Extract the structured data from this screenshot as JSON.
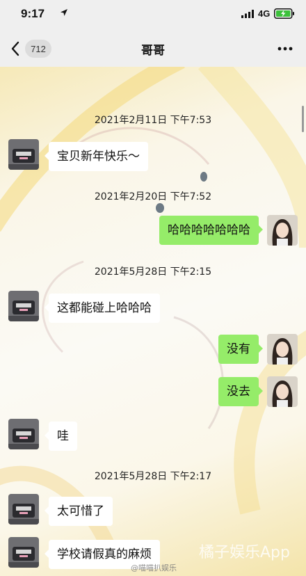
{
  "status_bar": {
    "time": "9:17",
    "network": "4G"
  },
  "nav": {
    "back_count": "712",
    "title": "哥哥"
  },
  "messages": [
    {
      "type": "timestamp",
      "text": "2021年2月11日 下午7:53"
    },
    {
      "type": "message",
      "side": "left",
      "text": "宝贝新年快乐～"
    },
    {
      "type": "timestamp",
      "text": "2021年2月20日 下午7:52"
    },
    {
      "type": "message",
      "side": "right",
      "text": "哈哈哈哈哈哈哈"
    },
    {
      "type": "timestamp",
      "text": "2021年5月28日 下午2:15"
    },
    {
      "type": "message",
      "side": "left",
      "text": "这都能碰上哈哈哈"
    },
    {
      "type": "message",
      "side": "right",
      "text": "没有"
    },
    {
      "type": "message",
      "side": "right",
      "text": "没去"
    },
    {
      "type": "message",
      "side": "left",
      "text": "哇"
    },
    {
      "type": "timestamp",
      "text": "2021年5月28日 下午2:17"
    },
    {
      "type": "message",
      "side": "left",
      "text": "太可惜了"
    },
    {
      "type": "message",
      "side": "left",
      "text": "学校请假真的麻烦"
    }
  ],
  "watermark": {
    "brand": "橘子娱乐App",
    "credit": "@喵喵扒娱乐"
  },
  "colors": {
    "bubble_right": "#95ec69",
    "bubble_left": "#ffffff",
    "bar_bg": "#efefef"
  }
}
